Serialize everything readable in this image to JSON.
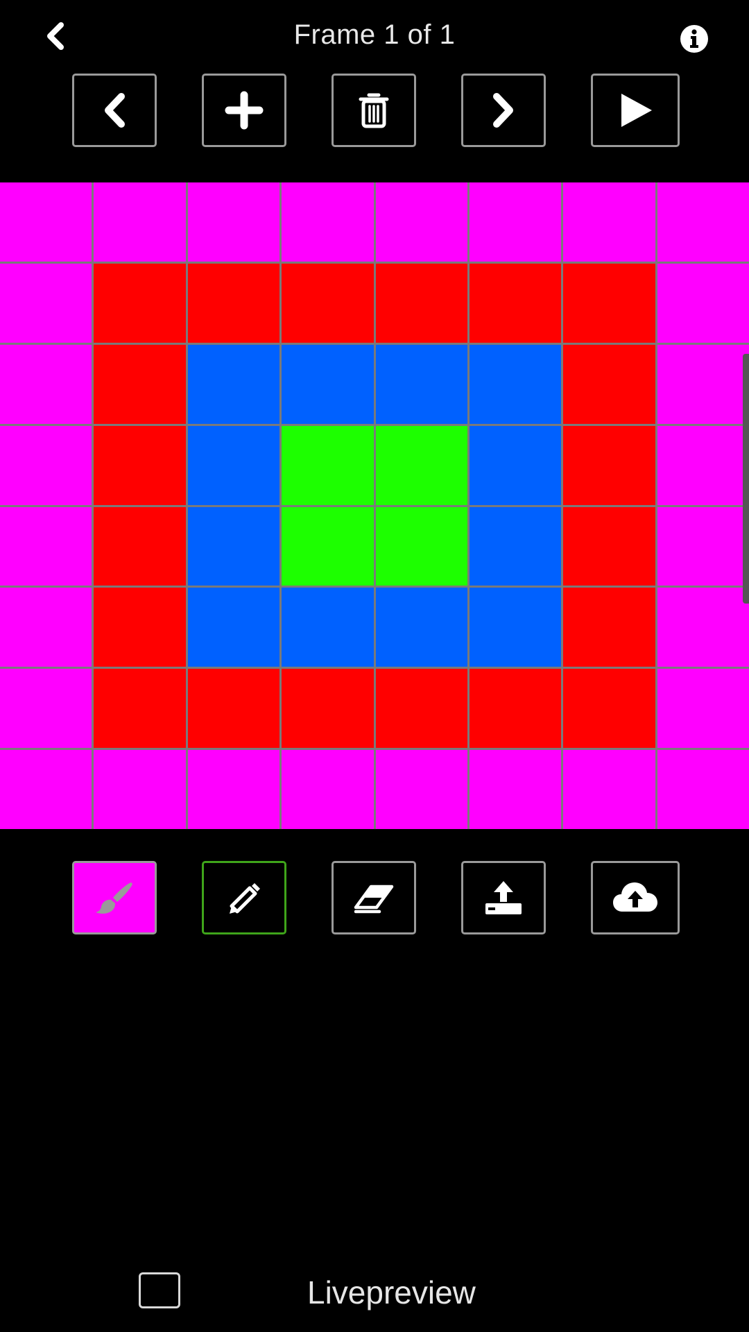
{
  "header": {
    "title": "Frame 1 of 1",
    "back_icon": "chevron-left-icon",
    "info_icon": "info-icon"
  },
  "frame_toolbar": [
    {
      "name": "prev-frame-button",
      "icon": "chevron-left-icon"
    },
    {
      "name": "add-frame-button",
      "icon": "plus-icon"
    },
    {
      "name": "delete-frame-button",
      "icon": "trash-icon"
    },
    {
      "name": "next-frame-button",
      "icon": "chevron-right-icon"
    },
    {
      "name": "play-button",
      "icon": "play-icon"
    }
  ],
  "palette": {
    "magenta": "#ff00ff",
    "red": "#ff0000",
    "blue": "#0061ff",
    "green": "#1dff00"
  },
  "grid": {
    "rows": 8,
    "cols": 8,
    "cells": [
      [
        "magenta",
        "magenta",
        "magenta",
        "magenta",
        "magenta",
        "magenta",
        "magenta",
        "magenta"
      ],
      [
        "magenta",
        "red",
        "red",
        "red",
        "red",
        "red",
        "red",
        "magenta"
      ],
      [
        "magenta",
        "red",
        "blue",
        "blue",
        "blue",
        "blue",
        "red",
        "magenta"
      ],
      [
        "magenta",
        "red",
        "blue",
        "green",
        "green",
        "blue",
        "red",
        "magenta"
      ],
      [
        "magenta",
        "red",
        "blue",
        "green",
        "green",
        "blue",
        "red",
        "magenta"
      ],
      [
        "magenta",
        "red",
        "blue",
        "blue",
        "blue",
        "blue",
        "red",
        "magenta"
      ],
      [
        "magenta",
        "red",
        "red",
        "red",
        "red",
        "red",
        "red",
        "magenta"
      ],
      [
        "magenta",
        "magenta",
        "magenta",
        "magenta",
        "magenta",
        "magenta",
        "magenta",
        "magenta"
      ]
    ]
  },
  "tool_toolbar": [
    {
      "name": "brush-color-button",
      "icon": "brush-icon",
      "selected_color": "#ff00ff"
    },
    {
      "name": "pencil-tool-button",
      "icon": "pencil-icon",
      "active": true,
      "border_color": "#3fa51a"
    },
    {
      "name": "eraser-tool-button",
      "icon": "eraser-icon"
    },
    {
      "name": "upload-button",
      "icon": "upload-icon"
    },
    {
      "name": "cloud-upload-button",
      "icon": "cloud-upload-icon"
    }
  ],
  "livepreview": {
    "label": "Livepreview",
    "checked": false
  }
}
